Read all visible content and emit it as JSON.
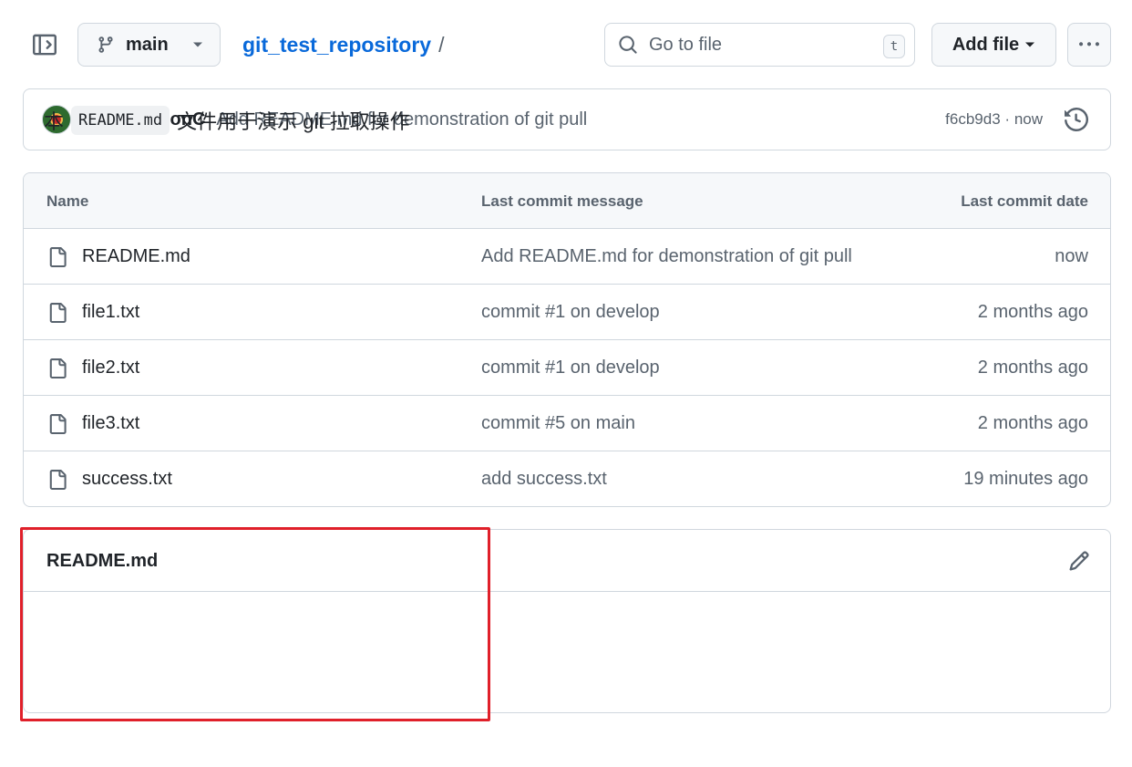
{
  "topbar": {
    "branch": "main",
    "repo_name": "git_test_repository",
    "path_separator": "/",
    "search_placeholder": "Go to file",
    "search_shortcut": "t",
    "add_file_label": "Add file"
  },
  "latest_commit": {
    "author": "WintermelonC",
    "message": "Add README.md for demonstration of git pull",
    "hash": "f6cb9d3",
    "separator": "·",
    "time": "now"
  },
  "file_table": {
    "headers": {
      "name": "Name",
      "message": "Last commit message",
      "date": "Last commit date"
    },
    "rows": [
      {
        "name": "README.md",
        "message": "Add README.md for demonstration of git pull",
        "date": "now"
      },
      {
        "name": "file1.txt",
        "message": "commit #1 on develop",
        "date": "2 months ago"
      },
      {
        "name": "file2.txt",
        "message": "commit #1 on develop",
        "date": "2 months ago"
      },
      {
        "name": "file3.txt",
        "message": "commit #5 on main",
        "date": "2 months ago"
      },
      {
        "name": "success.txt",
        "message": "add success.txt",
        "date": "19 minutes ago"
      }
    ]
  },
  "readme": {
    "title": "README.md",
    "text_before": "本",
    "code": "README.md",
    "text_after": "文件用于演示 git 拉取操作"
  },
  "colors": {
    "accent_link": "#0969da",
    "highlight_border": "#e0202a",
    "muted_text": "#59636e",
    "border": "#d0d7de"
  },
  "icons": [
    "sidebar-toggle-icon",
    "git-branch-icon",
    "caret-down-icon",
    "search-icon",
    "kebab-horizontal-icon",
    "history-icon",
    "file-icon",
    "pencil-icon"
  ]
}
